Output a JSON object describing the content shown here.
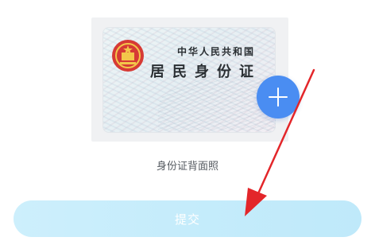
{
  "upload": {
    "card_line1": "中华人民共和国",
    "card_line2": "居民身份证",
    "caption": "身份证背面照",
    "add_icon": "plus-icon"
  },
  "actions": {
    "submit_label": "提交"
  },
  "annotation": {
    "arrow_color": "#e3262a"
  },
  "colors": {
    "add_button": "#4a8df2",
    "submit_button": "#c5ecfb"
  }
}
